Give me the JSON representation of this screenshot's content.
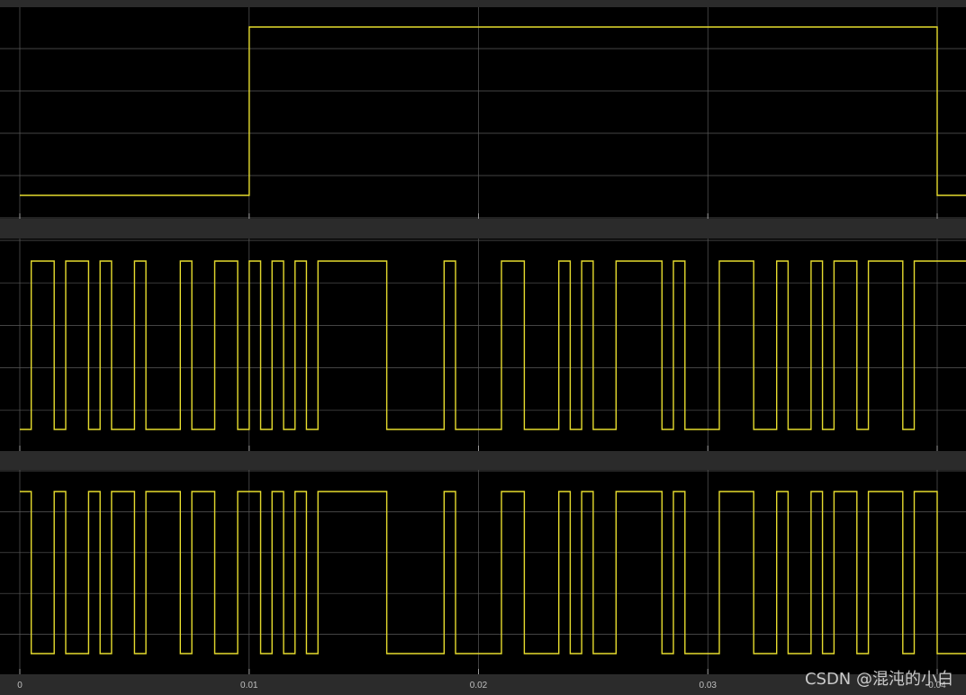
{
  "chart_data": [
    {
      "type": "line",
      "step": true,
      "xlim": [
        0,
        0.04
      ],
      "ylim": [
        0,
        1
      ],
      "grid": true,
      "x_ticks": [
        0,
        0.01,
        0.02,
        0.03,
        0.04
      ],
      "series": [
        {
          "points": [
            [
              0,
              0
            ],
            [
              0.01,
              0
            ],
            [
              0.01,
              1
            ],
            [
              0.04,
              1
            ],
            [
              0.04,
              0
            ],
            [
              0.0413,
              0
            ]
          ]
        }
      ]
    },
    {
      "type": "line",
      "step": true,
      "xlim": [
        0,
        0.04
      ],
      "ylim": [
        0,
        1
      ],
      "grid": true,
      "x_ticks": [
        0,
        0.01,
        0.02,
        0.03,
        0.04
      ],
      "series": [
        {
          "points": [
            [
              0,
              0
            ],
            [
              0.0005,
              0
            ],
            [
              0.0005,
              1
            ],
            [
              0.0015,
              1
            ],
            [
              0.0015,
              0
            ],
            [
              0.002,
              0
            ],
            [
              0.002,
              1
            ],
            [
              0.003,
              1
            ],
            [
              0.003,
              0
            ],
            [
              0.0035,
              0
            ],
            [
              0.0035,
              1
            ],
            [
              0.004,
              1
            ],
            [
              0.004,
              0
            ],
            [
              0.005,
              0
            ],
            [
              0.005,
              1
            ],
            [
              0.0055,
              1
            ],
            [
              0.0055,
              0
            ],
            [
              0.007,
              0
            ],
            [
              0.007,
              1
            ],
            [
              0.0075,
              1
            ],
            [
              0.0075,
              0
            ],
            [
              0.0085,
              0
            ],
            [
              0.0085,
              1
            ],
            [
              0.0095,
              1
            ],
            [
              0.0095,
              0
            ],
            [
              0.01,
              0
            ],
            [
              0.01,
              1
            ],
            [
              0.0105,
              1
            ],
            [
              0.0105,
              0
            ],
            [
              0.011,
              0
            ],
            [
              0.011,
              1
            ],
            [
              0.0115,
              1
            ],
            [
              0.0115,
              0
            ],
            [
              0.012,
              0
            ],
            [
              0.012,
              1
            ],
            [
              0.0125,
              1
            ],
            [
              0.0125,
              0
            ],
            [
              0.013,
              0
            ],
            [
              0.013,
              1
            ],
            [
              0.016,
              1
            ],
            [
              0.016,
              0
            ],
            [
              0.0185,
              0
            ],
            [
              0.0185,
              1
            ],
            [
              0.019,
              1
            ],
            [
              0.019,
              0
            ],
            [
              0.021,
              0
            ],
            [
              0.021,
              1
            ],
            [
              0.022,
              1
            ],
            [
              0.022,
              0
            ],
            [
              0.0235,
              0
            ],
            [
              0.0235,
              1
            ],
            [
              0.024,
              1
            ],
            [
              0.024,
              0
            ],
            [
              0.0245,
              0
            ],
            [
              0.0245,
              1
            ],
            [
              0.025,
              1
            ],
            [
              0.025,
              0
            ],
            [
              0.026,
              0
            ],
            [
              0.026,
              1
            ],
            [
              0.028,
              1
            ],
            [
              0.028,
              0
            ],
            [
              0.0285,
              0
            ],
            [
              0.0285,
              1
            ],
            [
              0.029,
              1
            ],
            [
              0.029,
              0
            ],
            [
              0.0305,
              0
            ],
            [
              0.0305,
              1
            ],
            [
              0.032,
              1
            ],
            [
              0.032,
              0
            ],
            [
              0.033,
              0
            ],
            [
              0.033,
              1
            ],
            [
              0.0335,
              1
            ],
            [
              0.0335,
              0
            ],
            [
              0.0345,
              0
            ],
            [
              0.0345,
              1
            ],
            [
              0.035,
              1
            ],
            [
              0.035,
              0
            ],
            [
              0.0355,
              0
            ],
            [
              0.0355,
              1
            ],
            [
              0.0365,
              1
            ],
            [
              0.0365,
              0
            ],
            [
              0.037,
              0
            ],
            [
              0.037,
              1
            ],
            [
              0.0385,
              1
            ],
            [
              0.0385,
              0
            ],
            [
              0.039,
              0
            ],
            [
              0.039,
              1
            ],
            [
              0.0413,
              1
            ]
          ]
        }
      ]
    },
    {
      "type": "line",
      "step": true,
      "xlim": [
        0,
        0.04
      ],
      "ylim": [
        0,
        1
      ],
      "grid": true,
      "x_ticks": [
        0,
        0.01,
        0.02,
        0.03,
        0.04
      ],
      "x_tick_labels": [
        "0",
        "0.01",
        "0.02",
        "0.03",
        "0.04"
      ],
      "series": [
        {
          "points": [
            [
              0,
              1
            ],
            [
              0.0005,
              1
            ],
            [
              0.0005,
              0
            ],
            [
              0.0015,
              0
            ],
            [
              0.0015,
              1
            ],
            [
              0.002,
              1
            ],
            [
              0.002,
              0
            ],
            [
              0.003,
              0
            ],
            [
              0.003,
              1
            ],
            [
              0.0035,
              1
            ],
            [
              0.0035,
              0
            ],
            [
              0.004,
              0
            ],
            [
              0.004,
              1
            ],
            [
              0.005,
              1
            ],
            [
              0.005,
              0
            ],
            [
              0.0055,
              0
            ],
            [
              0.0055,
              1
            ],
            [
              0.007,
              1
            ],
            [
              0.007,
              0
            ],
            [
              0.0075,
              0
            ],
            [
              0.0075,
              1
            ],
            [
              0.0085,
              1
            ],
            [
              0.0085,
              0
            ],
            [
              0.0095,
              0
            ],
            [
              0.0095,
              1
            ],
            [
              0.0105,
              1
            ],
            [
              0.0105,
              0
            ],
            [
              0.011,
              0
            ],
            [
              0.011,
              1
            ],
            [
              0.0115,
              1
            ],
            [
              0.0115,
              0
            ],
            [
              0.012,
              0
            ],
            [
              0.012,
              1
            ],
            [
              0.0125,
              1
            ],
            [
              0.0125,
              0
            ],
            [
              0.013,
              0
            ],
            [
              0.013,
              1
            ],
            [
              0.016,
              1
            ],
            [
              0.016,
              0
            ],
            [
              0.0185,
              0
            ],
            [
              0.0185,
              1
            ],
            [
              0.019,
              1
            ],
            [
              0.019,
              0
            ],
            [
              0.021,
              0
            ],
            [
              0.021,
              1
            ],
            [
              0.022,
              1
            ],
            [
              0.022,
              0
            ],
            [
              0.0235,
              0
            ],
            [
              0.0235,
              1
            ],
            [
              0.024,
              1
            ],
            [
              0.024,
              0
            ],
            [
              0.0245,
              0
            ],
            [
              0.0245,
              1
            ],
            [
              0.025,
              1
            ],
            [
              0.025,
              0
            ],
            [
              0.026,
              0
            ],
            [
              0.026,
              1
            ],
            [
              0.028,
              1
            ],
            [
              0.028,
              0
            ],
            [
              0.0285,
              0
            ],
            [
              0.0285,
              1
            ],
            [
              0.029,
              1
            ],
            [
              0.029,
              0
            ],
            [
              0.0305,
              0
            ],
            [
              0.0305,
              1
            ],
            [
              0.032,
              1
            ],
            [
              0.032,
              0
            ],
            [
              0.033,
              0
            ],
            [
              0.033,
              1
            ],
            [
              0.0335,
              1
            ],
            [
              0.0335,
              0
            ],
            [
              0.0345,
              0
            ],
            [
              0.0345,
              1
            ],
            [
              0.035,
              1
            ],
            [
              0.035,
              0
            ],
            [
              0.0355,
              0
            ],
            [
              0.0355,
              1
            ],
            [
              0.0365,
              1
            ],
            [
              0.0365,
              0
            ],
            [
              0.037,
              0
            ],
            [
              0.037,
              1
            ],
            [
              0.0385,
              1
            ],
            [
              0.0385,
              0
            ],
            [
              0.039,
              0
            ],
            [
              0.039,
              1
            ],
            [
              0.04,
              1
            ],
            [
              0.04,
              0
            ],
            [
              0.0413,
              0
            ]
          ]
        }
      ]
    }
  ],
  "colors": {
    "signal": "#e6dc2e",
    "plot_background": "#000000",
    "grid": "#5a5a5a",
    "frame": "#2b2b2b"
  },
  "watermark": "CSDN @混沌的小白"
}
